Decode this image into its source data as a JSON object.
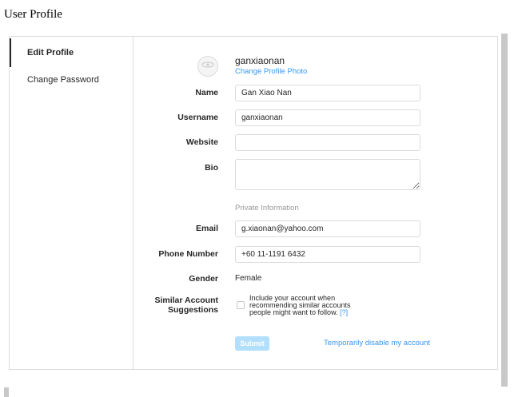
{
  "page": {
    "title": "User Profile"
  },
  "sidebar": {
    "items": [
      {
        "label": "Edit Profile",
        "active": true
      },
      {
        "label": "Change Password",
        "active": false
      }
    ]
  },
  "profile": {
    "username": "ganxiaonan",
    "change_photo_label": "Change Profile Photo",
    "avatar_icon": "user-avatar-icon"
  },
  "form": {
    "name": {
      "label": "Name",
      "value": "Gan Xiao Nan"
    },
    "username": {
      "label": "Username",
      "value": "ganxiaonan"
    },
    "website": {
      "label": "Website",
      "value": ""
    },
    "bio": {
      "label": "Bio",
      "value": ""
    },
    "private_heading": "Private Information",
    "email": {
      "label": "Email",
      "value": "g.xiaonan@yahoo.com"
    },
    "phone": {
      "label": "Phone Number",
      "value": "+60 11-1191 6432"
    },
    "gender": {
      "label": "Gender",
      "value": "Female"
    },
    "similar": {
      "label_line1": "Similar Account",
      "label_line2": "Suggestions",
      "text": "Include your account when recommending similar accounts people might want to follow.",
      "help": "[?]",
      "checked": false
    },
    "submit_label": "Submit",
    "disable_label": "Temporarily disable my account"
  },
  "colors": {
    "accent": "#3897f0",
    "submit_disabled": "#b2dffc",
    "border": "#dbdbdb"
  }
}
